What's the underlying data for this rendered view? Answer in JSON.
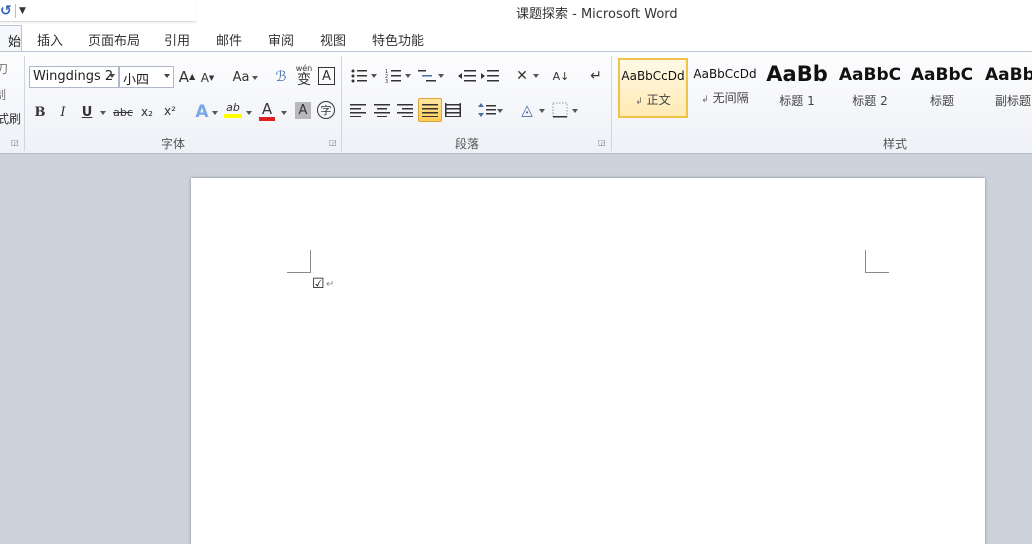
{
  "titlebar": {
    "title": "课题探索 - Microsoft Word",
    "undo_icon": "undo-icon",
    "qat_dropdown_icon": "chevron-down-icon"
  },
  "tabs": {
    "active_fragment": "始",
    "items": [
      "插入",
      "页面布局",
      "引用",
      "邮件",
      "审阅",
      "视图",
      "特色功能"
    ]
  },
  "clipboard_fragments": [
    "刀",
    "制",
    "式刷"
  ],
  "font_group": {
    "font_name": "Wingdings 2",
    "font_size": "小四",
    "grow_font": "A",
    "shrink_font": "A",
    "change_case": "Aa",
    "clear_formatting_icon": "clear-format-icon",
    "phonetic": "wén",
    "phonetic_char": "变",
    "char_border": "A",
    "bold": "B",
    "italic": "I",
    "underline": "U",
    "strikethrough": "abc",
    "subscript": "x₂",
    "superscript": "x²",
    "text_effects": "A",
    "highlight": "ab",
    "font_color": "A",
    "char_shading": "A",
    "enclose_char": "字",
    "label": "字体"
  },
  "paragraph_group": {
    "label": "段落",
    "icons": [
      "bullets-icon",
      "numbering-icon",
      "multilevel-list-icon",
      "decrease-indent-icon",
      "increase-indent-icon",
      "chinese-layout-icon",
      "sort-icon",
      "show-marks-icon",
      "align-left-icon",
      "center-icon",
      "align-right-icon",
      "justify-icon",
      "distributed-icon",
      "line-spacing-icon",
      "shading-icon",
      "borders-icon"
    ]
  },
  "styles_group": {
    "label": "样式",
    "items": [
      {
        "sample": "AaBbCcDd",
        "name": "正文",
        "mark": "↲"
      },
      {
        "sample": "AaBbCcDd",
        "name": "无间隔",
        "mark": "↲"
      },
      {
        "sample": "AaBb",
        "name": "标题 1",
        "mark": ""
      },
      {
        "sample": "AaBbC",
        "name": "标题 2",
        "mark": ""
      },
      {
        "sample": "AaBbC",
        "name": "标题",
        "mark": ""
      },
      {
        "sample": "AaBb",
        "name": "副标题",
        "mark": ""
      }
    ]
  },
  "document": {
    "checkbox_glyph": "☑",
    "paragraph_mark": "↵"
  },
  "colors": {
    "ribbon_top": "#fdfdfe",
    "ribbon_bottom": "#eef1f6",
    "doc_background": "#ccd2db",
    "selected_style_border": "#f0c24a",
    "font_color_bar": "#e02020",
    "highlight_bar": "#ffff00"
  }
}
